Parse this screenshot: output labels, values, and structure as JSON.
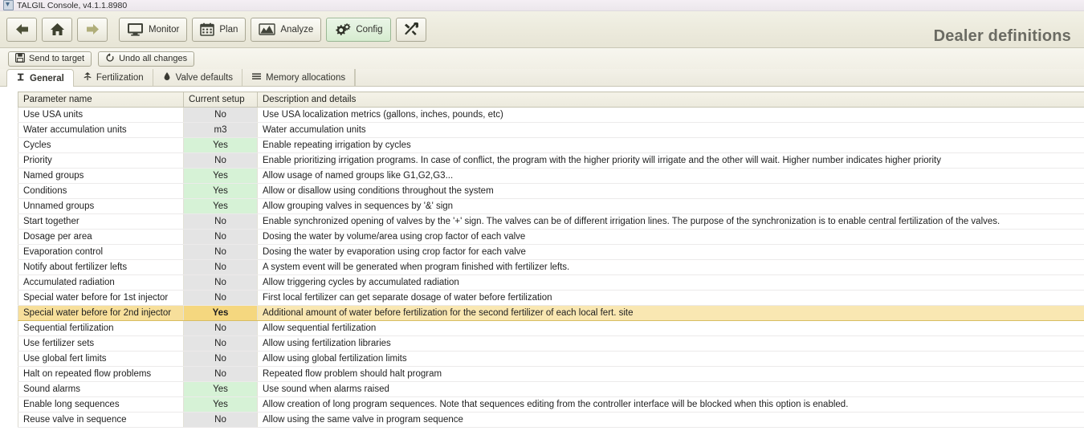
{
  "window": {
    "title": "TALGIL Console, v4.1.1.8980",
    "icon": "app-icon"
  },
  "toolbar": {
    "nav": [
      {
        "name": "back",
        "icon": "arrow-left-icon",
        "label": ""
      },
      {
        "name": "home",
        "icon": "home-icon",
        "label": ""
      },
      {
        "name": "forward",
        "icon": "arrow-right-icon",
        "label": ""
      }
    ],
    "sections": [
      {
        "name": "monitor",
        "icon": "monitor-icon",
        "label": "Monitor",
        "active": false
      },
      {
        "name": "plan",
        "icon": "calendar-icon",
        "label": "Plan",
        "active": false
      },
      {
        "name": "analyze",
        "icon": "chart-icon",
        "label": "Analyze",
        "active": false
      },
      {
        "name": "config",
        "icon": "gears-icon",
        "label": "Config",
        "active": true
      },
      {
        "name": "tools",
        "icon": "tools-icon",
        "label": "",
        "active": false
      }
    ],
    "page_title": "Dealer definitions"
  },
  "actions": [
    {
      "name": "send-to-target",
      "icon": "save-icon",
      "label": "Send to target"
    },
    {
      "name": "undo-all-changes",
      "icon": "undo-icon",
      "label": "Undo all changes"
    }
  ],
  "tabs": [
    {
      "name": "general",
      "icon": "general-icon",
      "label": "General",
      "selected": true
    },
    {
      "name": "fertilization",
      "icon": "plant-icon",
      "label": "Fertilization",
      "selected": false
    },
    {
      "name": "valve-defaults",
      "icon": "drop-icon",
      "label": "Valve defaults",
      "selected": false
    },
    {
      "name": "memory-allocations",
      "icon": "list-icon",
      "label": "Memory allocations",
      "selected": false
    }
  ],
  "table": {
    "columns": [
      "Parameter name",
      "Current setup",
      "Description and details"
    ],
    "rows": [
      {
        "name": "Use USA units",
        "value": "No",
        "state": "no",
        "desc": "Use USA localization metrics (gallons, inches, pounds, etc)"
      },
      {
        "name": "Water accumulation units",
        "value": "m3",
        "state": "na",
        "desc": "Water accumulation units"
      },
      {
        "name": "Cycles",
        "value": "Yes",
        "state": "yes",
        "desc": "Enable repeating irrigation by cycles"
      },
      {
        "name": "Priority",
        "value": "No",
        "state": "no",
        "desc": "Enable prioritizing irrigation programs. In case of conflict, the program with the higher priority will irrigate and the other will wait. Higher number indicates higher priority"
      },
      {
        "name": "Named groups",
        "value": "Yes",
        "state": "yes",
        "desc": "Allow usage of named groups like G1,G2,G3..."
      },
      {
        "name": "Conditions",
        "value": "Yes",
        "state": "yes",
        "desc": "Allow or disallow using conditions throughout the system"
      },
      {
        "name": "Unnamed groups",
        "value": "Yes",
        "state": "yes",
        "desc": "Allow grouping valves in sequences by '&' sign"
      },
      {
        "name": "Start together",
        "value": "No",
        "state": "no",
        "desc": "Enable synchronized opening of valves by the '+' sign. The valves can be of different irrigation lines. The purpose of the synchronization is to enable central fertilization of the valves."
      },
      {
        "name": "Dosage per area",
        "value": "No",
        "state": "no",
        "desc": "Dosing the water by volume/area using crop factor of each valve"
      },
      {
        "name": "Evaporation control",
        "value": "No",
        "state": "no",
        "desc": "Dosing the water by evaporation using crop factor for each valve"
      },
      {
        "name": "Notify about fertilizer lefts",
        "value": "No",
        "state": "no",
        "desc": "A system event will be generated when program finished with fertilizer lefts."
      },
      {
        "name": "Accumulated radiation",
        "value": "No",
        "state": "no",
        "desc": "Allow triggering cycles by accumulated radiation"
      },
      {
        "name": "Special water before for 1st injector",
        "value": "No",
        "state": "no",
        "desc": "First local fertilizer can get separate dosage of water before fertilization"
      },
      {
        "name": "Special water before for 2nd injector",
        "value": "Yes",
        "state": "yes",
        "desc": "Additional amount of water before fertilization for the second fertilizer of each local fert. site",
        "highlighted": true
      },
      {
        "name": "Sequential fertilization",
        "value": "No",
        "state": "no",
        "desc": "Allow sequential fertilization"
      },
      {
        "name": "Use fertilizer sets",
        "value": "No",
        "state": "no",
        "desc": "Allow using fertilization libraries"
      },
      {
        "name": "Use global fert limits",
        "value": "No",
        "state": "no",
        "desc": "Allow using global fertilization limits"
      },
      {
        "name": "Halt on repeated flow problems",
        "value": "No",
        "state": "no",
        "desc": "Repeated flow problem should halt program"
      },
      {
        "name": "Sound alarms",
        "value": "Yes",
        "state": "yes",
        "desc": "Use sound when alarms raised"
      },
      {
        "name": "Enable long sequences",
        "value": "Yes",
        "state": "yes",
        "desc": "Allow creation of long program sequences. Note that sequences editing from the controller interface will be blocked when this option is enabled."
      },
      {
        "name": "Reuse valve in sequence",
        "value": "No",
        "state": "no",
        "desc": "Allow using the same valve in program sequence"
      }
    ]
  },
  "colors": {
    "accent_active": "#d5ebcf",
    "yes_cell": "#d6f2d6",
    "no_cell": "#e4e4e4",
    "highlight_row": "#f7df9b",
    "toolbar_bg": "#eceadc"
  }
}
